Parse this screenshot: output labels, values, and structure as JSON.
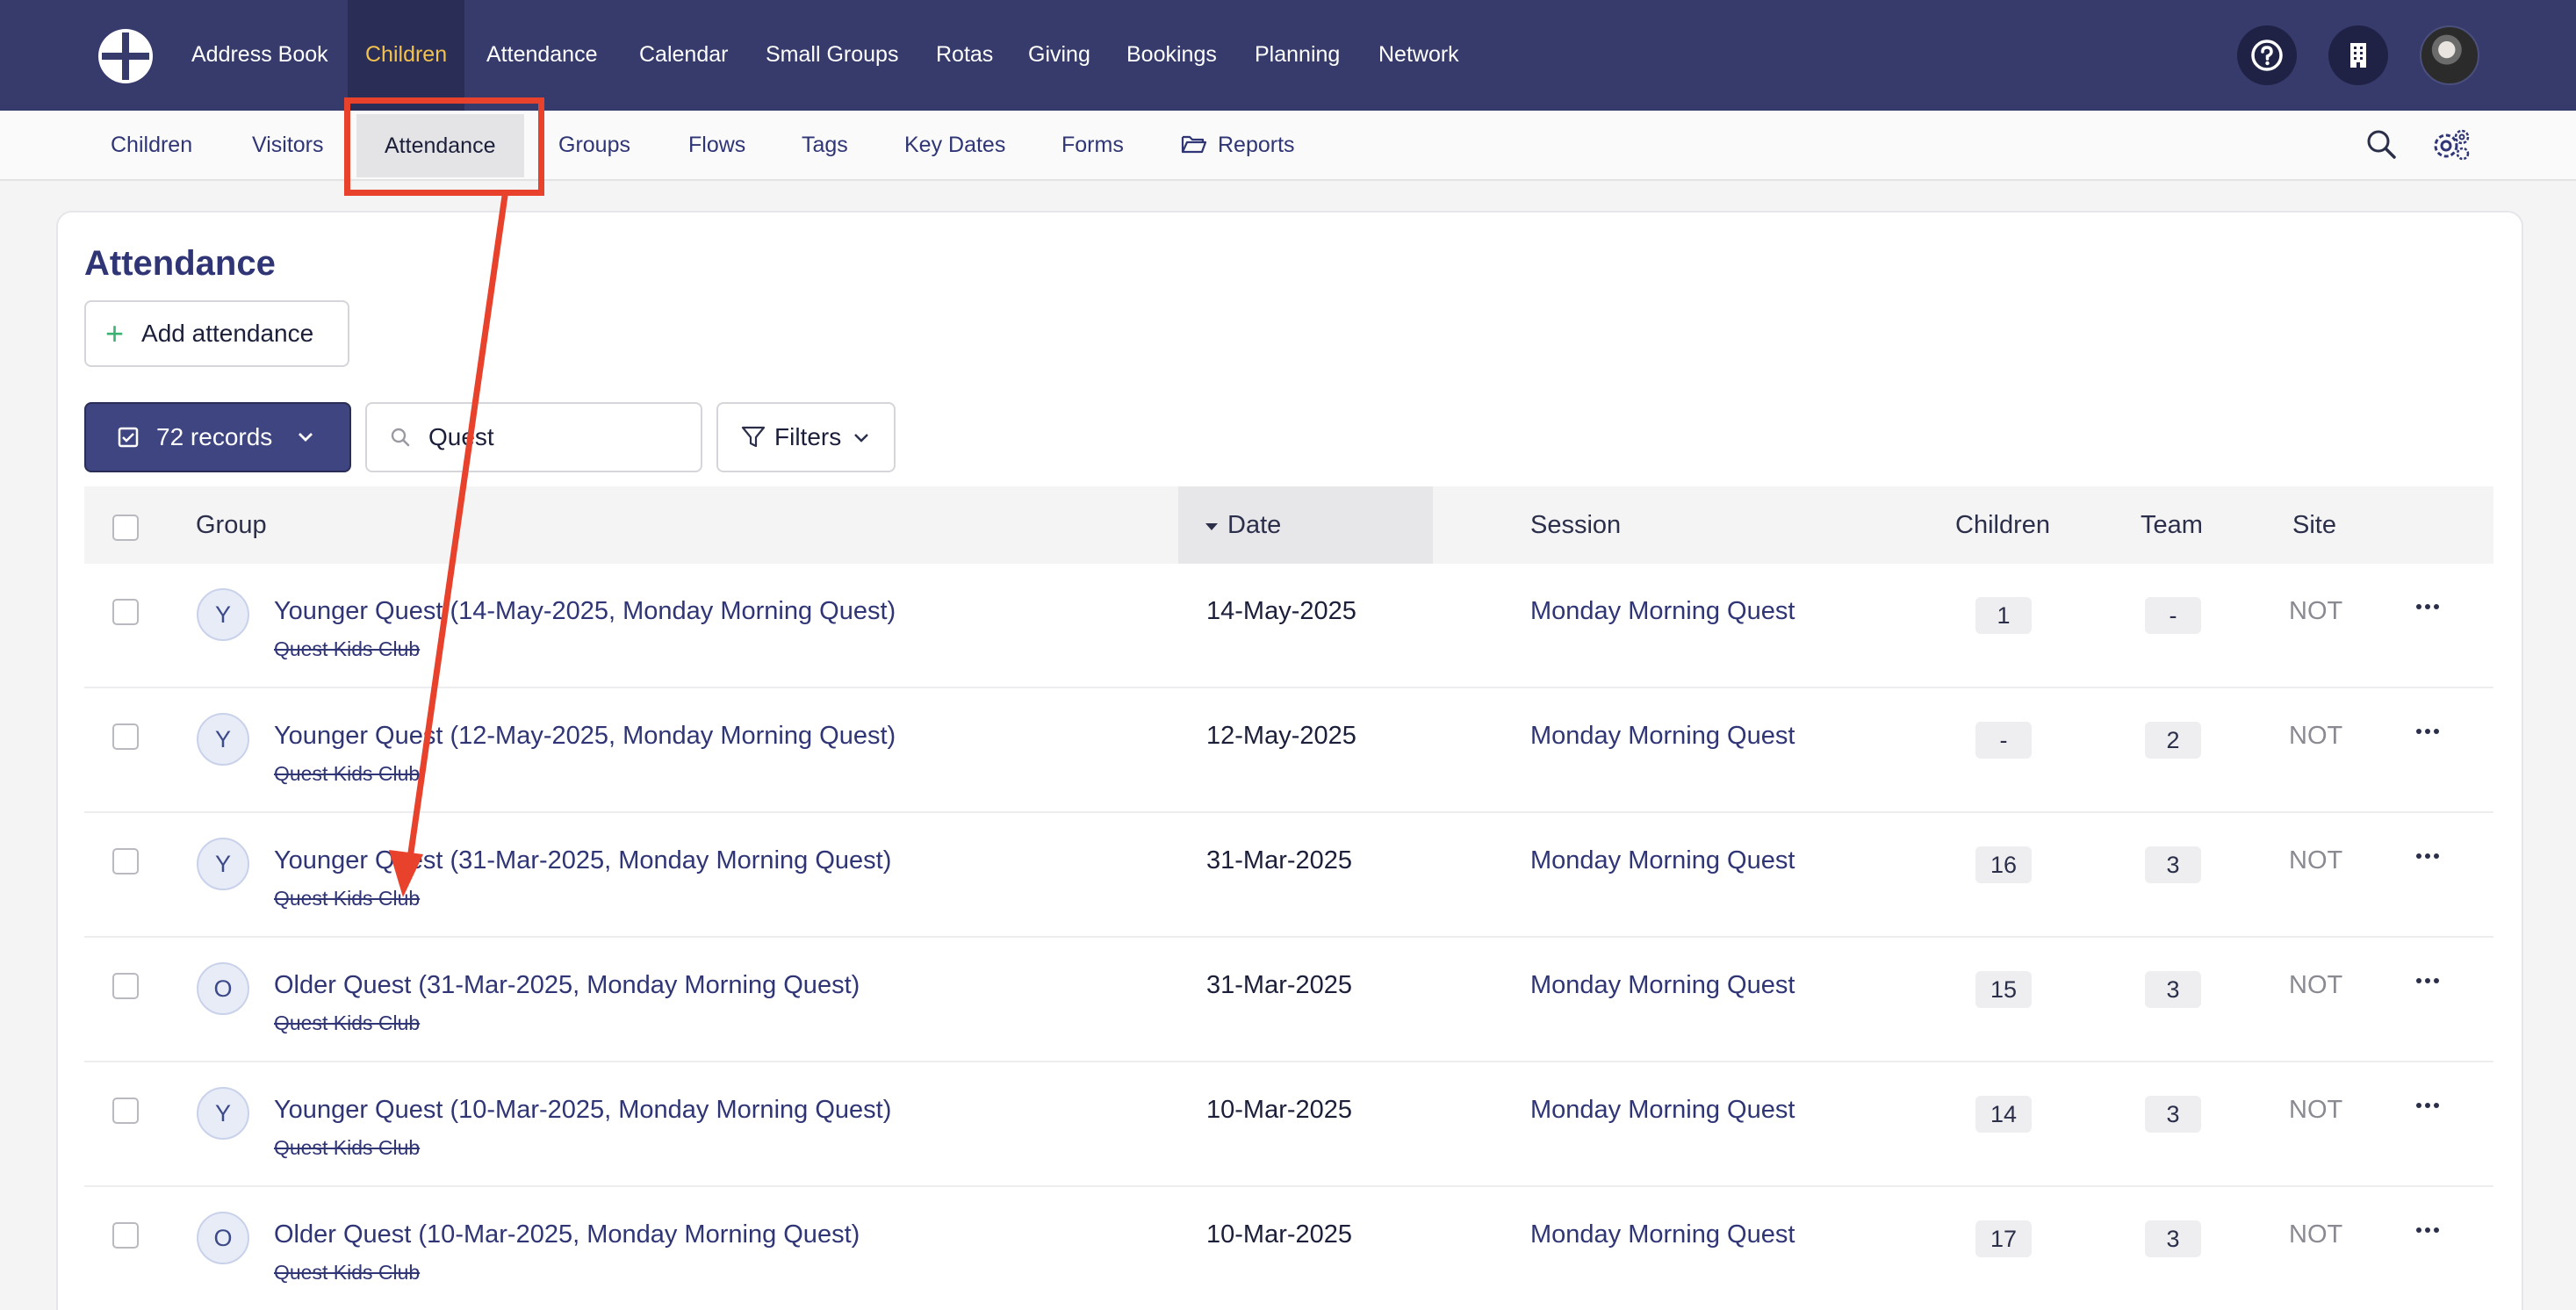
{
  "topnav": {
    "items": [
      {
        "label": "Address Book"
      },
      {
        "label": "Children"
      },
      {
        "label": "Attendance"
      },
      {
        "label": "Calendar"
      },
      {
        "label": "Small Groups"
      },
      {
        "label": "Rotas"
      },
      {
        "label": "Giving"
      },
      {
        "label": "Bookings"
      },
      {
        "label": "Planning"
      },
      {
        "label": "Network"
      }
    ],
    "active_item": "Children",
    "active_color": "#f2c14e",
    "background": "#363b6b",
    "icons": [
      "help-icon",
      "building-icon",
      "user-avatar"
    ]
  },
  "subnav": {
    "items": [
      {
        "label": "Children"
      },
      {
        "label": "Visitors"
      },
      {
        "label": "Attendance"
      },
      {
        "label": "Groups"
      },
      {
        "label": "Flows"
      },
      {
        "label": "Tags"
      },
      {
        "label": "Key Dates"
      },
      {
        "label": "Forms"
      },
      {
        "label": "Reports"
      }
    ],
    "active_item": "Attendance",
    "icons": [
      "search-icon",
      "settings-gear-icon"
    ]
  },
  "main": {
    "title": "Attendance",
    "add_button": "Add attendance",
    "records_button": "72 records",
    "search_value": "Quest",
    "filters_button": "Filters"
  },
  "table": {
    "columns": {
      "group": "Group",
      "date": "Date",
      "session": "Session",
      "children": "Children",
      "team": "Team",
      "site": "Site"
    },
    "sorted_by": "Date",
    "rows": [
      {
        "initial": "Y",
        "name": "Younger Quest (14-May-2025, Monday Morning Quest)",
        "club": "Quest Kids Club",
        "date": "14-May-2025",
        "session": "Monday Morning Quest",
        "children": "1",
        "team": "-",
        "site": "NOT"
      },
      {
        "initial": "Y",
        "name": "Younger Quest (12-May-2025, Monday Morning Quest)",
        "club": "Quest Kids Club",
        "date": "12-May-2025",
        "session": "Monday Morning Quest",
        "children": "-",
        "team": "2",
        "site": "NOT"
      },
      {
        "initial": "Y",
        "name": "Younger Quest (31-Mar-2025, Monday Morning Quest)",
        "club": "Quest Kids Club",
        "date": "31-Mar-2025",
        "session": "Monday Morning Quest",
        "children": "16",
        "team": "3",
        "site": "NOT"
      },
      {
        "initial": "O",
        "name": "Older Quest (31-Mar-2025, Monday Morning Quest)",
        "club": "Quest Kids Club",
        "date": "31-Mar-2025",
        "session": "Monday Morning Quest",
        "children": "15",
        "team": "3",
        "site": "NOT"
      },
      {
        "initial": "Y",
        "name": "Younger Quest (10-Mar-2025, Monday Morning Quest)",
        "club": "Quest Kids Club",
        "date": "10-Mar-2025",
        "session": "Monday Morning Quest",
        "children": "14",
        "team": "3",
        "site": "NOT"
      },
      {
        "initial": "O",
        "name": "Older Quest (10-Mar-2025, Monday Morning Quest)",
        "club": "Quest Kids Club",
        "date": "10-Mar-2025",
        "session": "Monday Morning Quest",
        "children": "17",
        "team": "3",
        "site": "NOT"
      }
    ]
  },
  "annotation": {
    "color": "#e8412c",
    "shapes": [
      "highlight-box",
      "arrow"
    ]
  }
}
